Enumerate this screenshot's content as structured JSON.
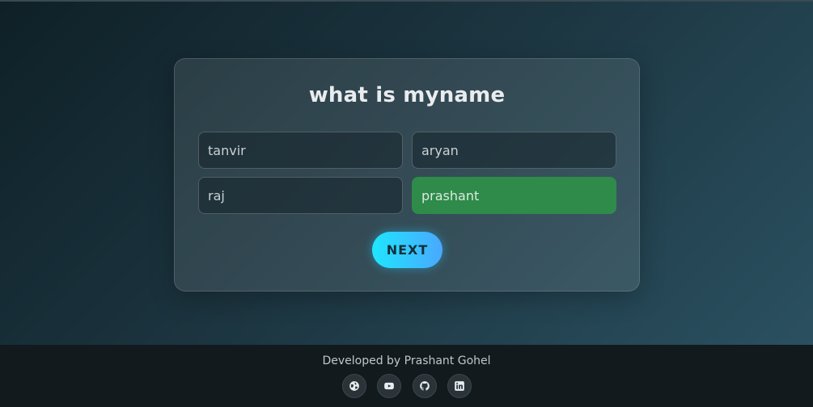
{
  "quiz": {
    "question": "what is myname",
    "options": [
      {
        "label": "tanvir",
        "state": "default"
      },
      {
        "label": "aryan",
        "state": "default"
      },
      {
        "label": "raj",
        "state": "default"
      },
      {
        "label": "prashant",
        "state": "correct"
      }
    ],
    "next_label": "NEXT"
  },
  "footer": {
    "credit": "Developed by Prashant Gohel",
    "links": [
      {
        "icon": "globe-icon"
      },
      {
        "icon": "youtube-icon"
      },
      {
        "icon": "github-icon"
      },
      {
        "icon": "linkedin-icon"
      }
    ]
  },
  "colors": {
    "correct": "#2e8b4a",
    "button_gradient_start": "#1ee6ff",
    "button_gradient_end": "#4aa8ff",
    "footer_bg": "#121a1e"
  }
}
